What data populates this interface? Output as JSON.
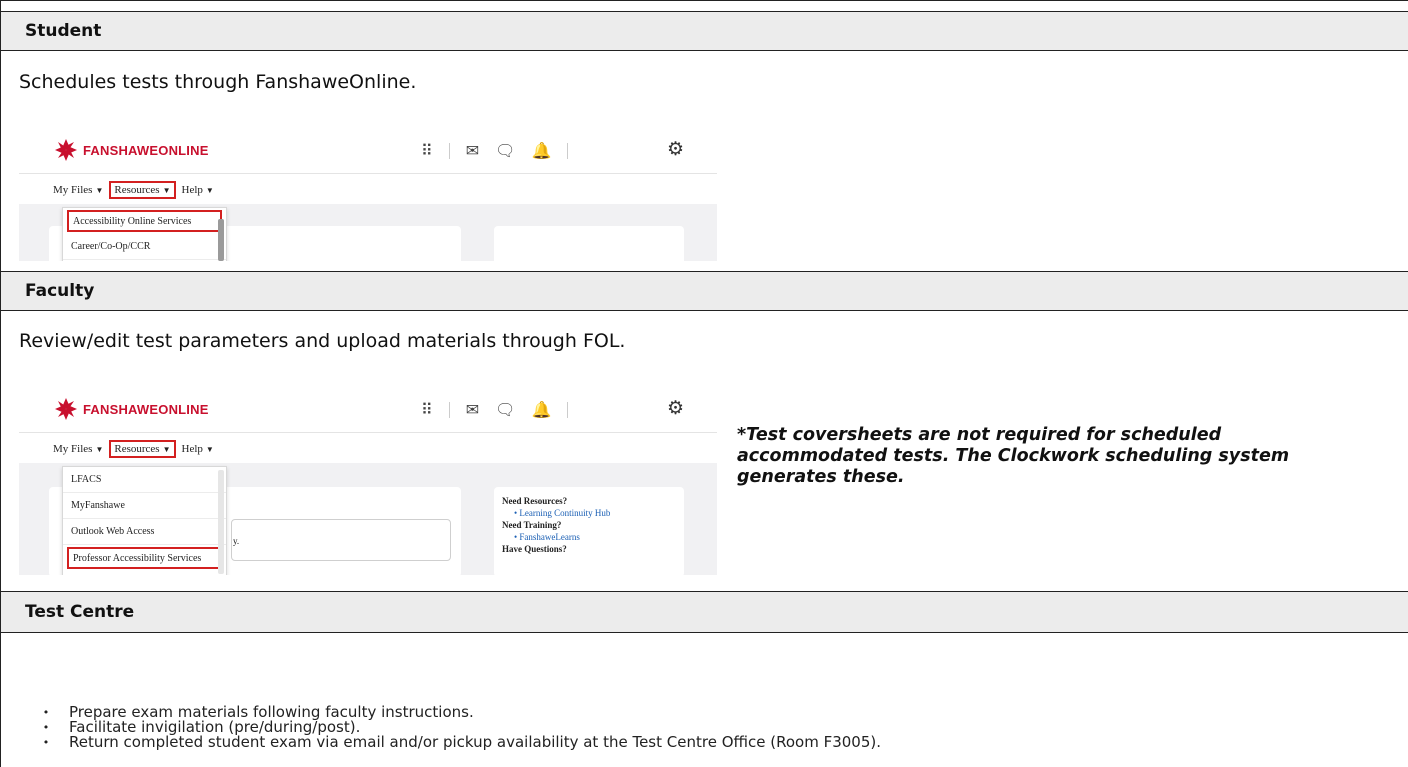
{
  "sections": [
    {
      "header": "Student",
      "text": "Schedules tests through FanshaweOnline."
    },
    {
      "header": "Faculty",
      "text": "Review/edit test parameters and upload materials through FOL."
    },
    {
      "header": "Test Centre",
      "bullets": [
        "Prepare exam materials following faculty instructions.",
        "Facilitate invigilation (pre/during/post).",
        "Return completed student exam via email and/or pickup availability at the Test Centre Office (Room F3005)."
      ]
    }
  ],
  "fol": {
    "logo_text": "FANSHAWEONLINE",
    "menu": {
      "my_files": "My Files",
      "resources": "Resources",
      "help": "Help"
    },
    "icons": [
      "apps-grid-icon",
      "mail-icon",
      "chat-icon",
      "bell-icon",
      "gear-icon"
    ],
    "student_dropdown": [
      "Accessibility Online Services",
      "Career/Co-Op/CCR"
    ],
    "faculty_dropdown": [
      "LFACS",
      "MyFanshawe",
      "Outlook Web Access",
      "Professor Accessibility Services"
    ],
    "faculty_links": {
      "need_resources": "Need Resources?",
      "learning_hub": "Learning Continuity Hub",
      "need_training": "Need Training?",
      "fanshawe_learns": "FanshaweLearns",
      "have_questions": "Have Questions?",
      "partial_text": "y."
    },
    "accent_color": "#c8102e",
    "highlight_color": "#d32020"
  },
  "note": "*Test coversheets are not required for scheduled accommodated tests. The Clockwork scheduling system generates these."
}
